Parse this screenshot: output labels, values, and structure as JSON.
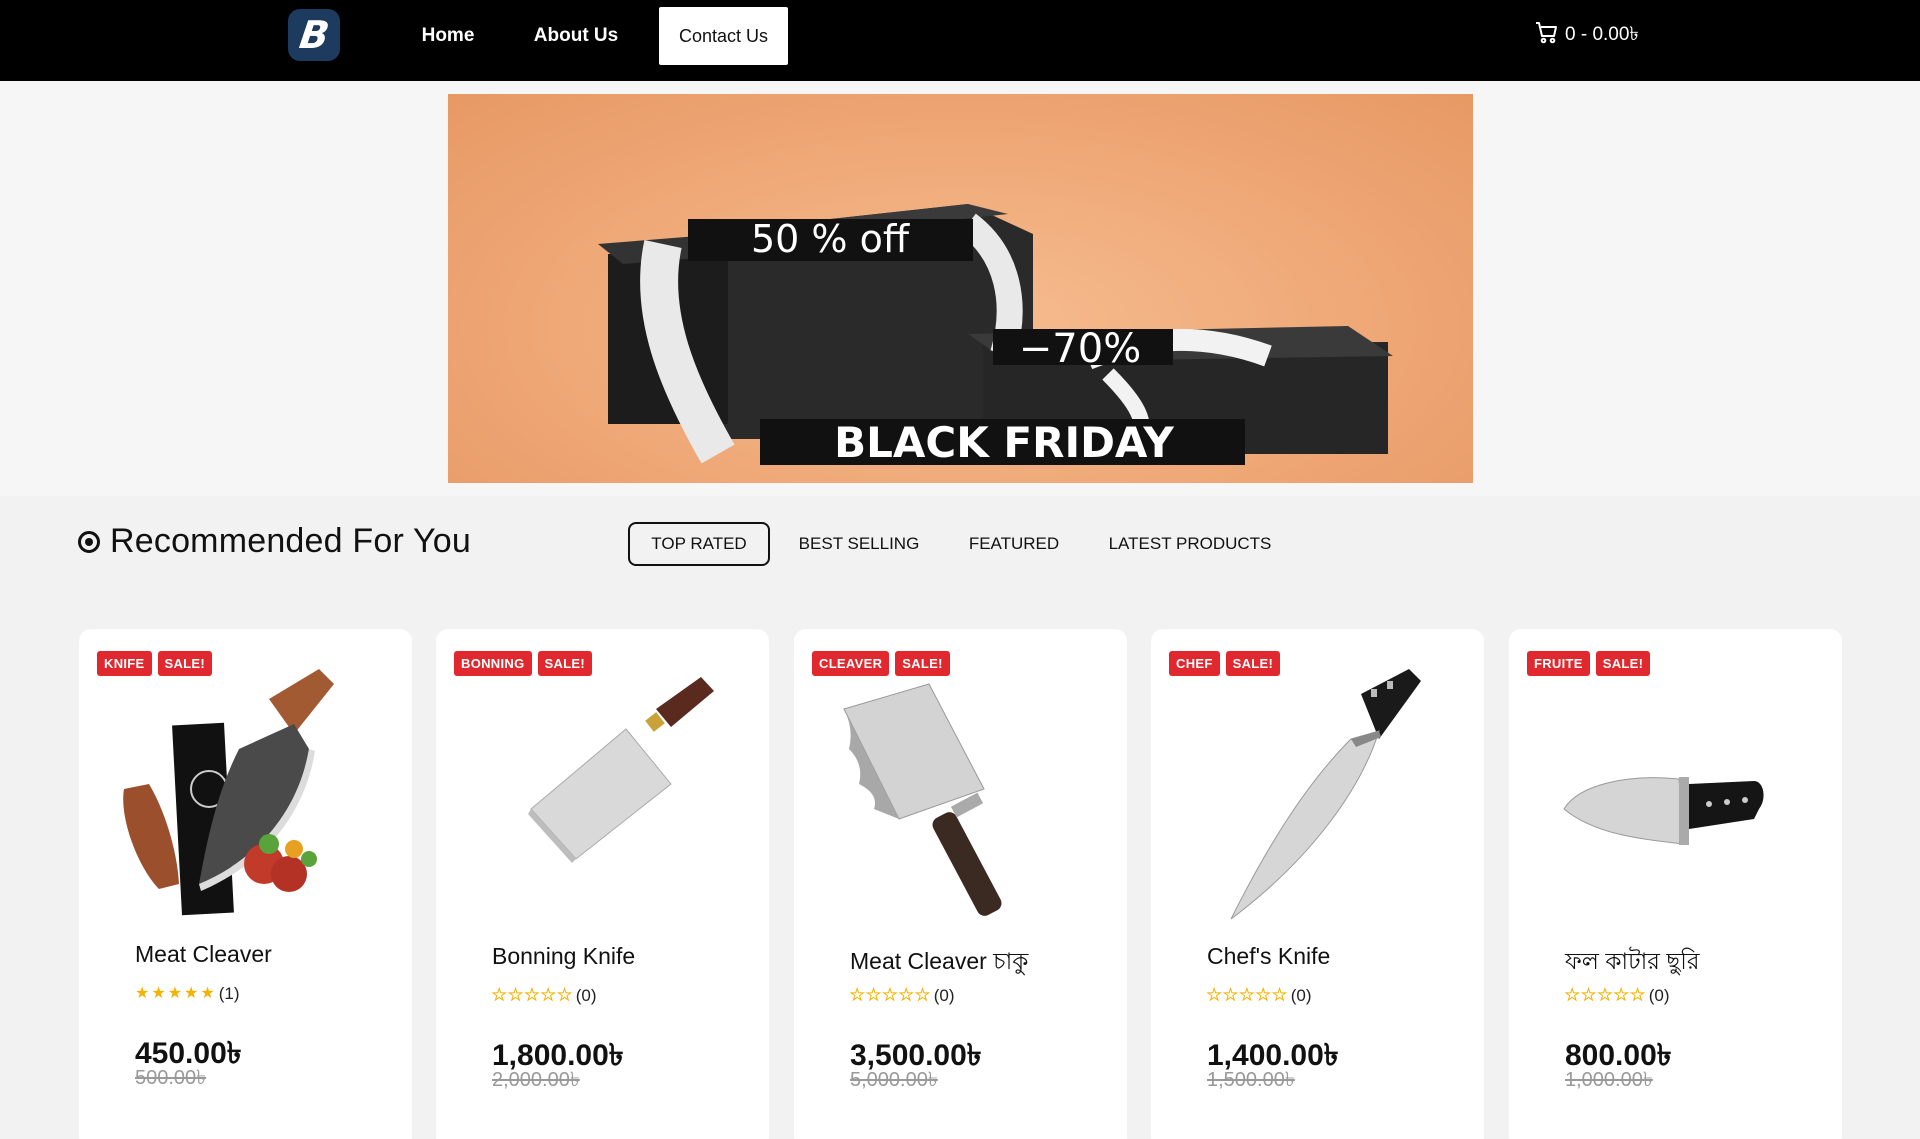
{
  "header": {
    "logo_letter": "B",
    "nav": [
      {
        "label": "Home"
      },
      {
        "label": "About Us"
      },
      {
        "label": "Contact Us"
      }
    ],
    "cart_text": "0 - 0.00৳"
  },
  "banner": {
    "text_top": "50 % off",
    "text_mid": "−70%",
    "text_bottom": "BLACK FRIDAY"
  },
  "section": {
    "title": "Recommended For You",
    "tabs": [
      {
        "label": "TOP RATED",
        "active": true
      },
      {
        "label": "BEST SELLING",
        "active": false
      },
      {
        "label": "FEATURED",
        "active": false
      },
      {
        "label": "LATEST PRODUCTS",
        "active": false
      }
    ]
  },
  "products": [
    {
      "category": "KNIFE",
      "sale": "SALE!",
      "name": "Meat Cleaver",
      "rating": 5,
      "reviews": "(1)",
      "price": "450.00৳",
      "old_price": "500.00৳",
      "image_icon": "boxed-cleaver-knife-set-icon"
    },
    {
      "category": "BONNING",
      "sale": "SALE!",
      "name": "Bonning Knife",
      "rating": 0,
      "reviews": "(0)",
      "price": "1,800.00৳",
      "old_price": "2,000.00৳",
      "image_icon": "chinese-cleaver-icon"
    },
    {
      "category": "CLEAVER",
      "sale": "SALE!",
      "name": "Meat Cleaver চাকু",
      "rating": 0,
      "reviews": "(0)",
      "price": "3,500.00৳",
      "old_price": "5,000.00৳",
      "image_icon": "wavy-cleaver-icon"
    },
    {
      "category": "CHEF",
      "sale": "SALE!",
      "name": "Chef's Knife",
      "rating": 0,
      "reviews": "(0)",
      "price": "1,400.00৳",
      "old_price": "1,500.00৳",
      "image_icon": "chef-knife-icon"
    },
    {
      "category": "FRUITE",
      "sale": "SALE!",
      "name": "ফল কাটার ছুরি",
      "rating": 0,
      "reviews": "(0)",
      "price": "800.00৳",
      "old_price": "1,000.00৳",
      "image_icon": "fruit-knife-icon"
    }
  ],
  "colors": {
    "header_bg": "#000000",
    "badge_red": "#e0282e",
    "star_gold": "#f5b301",
    "banner_peach": "#efa877"
  }
}
